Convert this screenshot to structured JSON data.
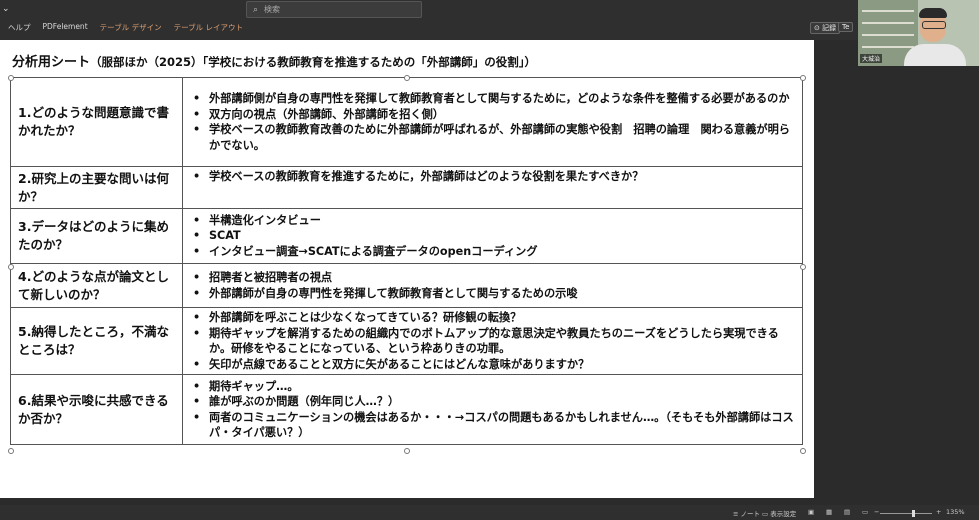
{
  "ribbon": {
    "search_placeholder": "検索",
    "tabs": [
      "ヘルプ",
      "PDFelement",
      "テーブル デザイン",
      "テーブル レイアウト"
    ],
    "record_label": "記録",
    "share_label": "Te"
  },
  "webcam": {
    "name": "大城治"
  },
  "slide": {
    "title_main": "分析用シート",
    "title_sub": "（服部ほか（2025）「学校における教師教育を推進するための「外部講師」の役割」）",
    "rows": [
      {
        "question": "1.どのような問題意識で書かれたか？",
        "answers": [
          "外部講師側が自身の専門性を発揮して教師教育者として関与するために，どのような条件を整備する必要があるのか",
          "双方向の視点（外部講師、外部講師を招く側）",
          "学校ベースの教師教育改善のために外部講師が呼ばれるが、外部講師の実態や役割　招聘の論理　関わる意義が明らかでない。"
        ]
      },
      {
        "question": "2.研究上の主要な問いは何か？",
        "answers": [
          "学校ベースの教師教育を推進するために，外部講師はどのような役割を果たすべきか？"
        ]
      },
      {
        "question": "3.データはどのように集めたのか？",
        "answers": [
          "半構造化インタビュー",
          "SCAT",
          "インタビュー調査→SCATによる調査データのopenコーディング"
        ]
      },
      {
        "question": "4.どのような点が論文として新しいのか？",
        "answers": [
          "招聘者と被招聘者の視点",
          "外部講師が自身の専門性を発揮して教師教育者として関与するための示唆"
        ]
      },
      {
        "question": "5.納得したところ，不満なところは？",
        "answers": [
          "外部講師を呼ぶことは少なくなってきている？研修観の転換？",
          "期待ギャップを解消するための組織内でのボトムアップ的な意思決定や教員たちのニーズをどうしたら実現できるか。研修をやることになっている、という枠ありきの功罪。",
          "矢印が点線であることと双方に矢があることにはどんな意味がありますか？"
        ]
      },
      {
        "question": "6.結果や示唆に共感できるか否か？",
        "answers": [
          "期待ギャップ…。",
          "誰が呼ぶのか問題（例年同じ人…？）",
          "両者のコミュニケーションの機会はあるか・・・→コスパの問題もあるかもしれません…。（そもそも外部講師はコスパ・タイパ悪い？）"
        ]
      }
    ]
  },
  "statusbar": {
    "notes": "ノート",
    "display_settings": "表示設定",
    "zoom": "135%"
  }
}
